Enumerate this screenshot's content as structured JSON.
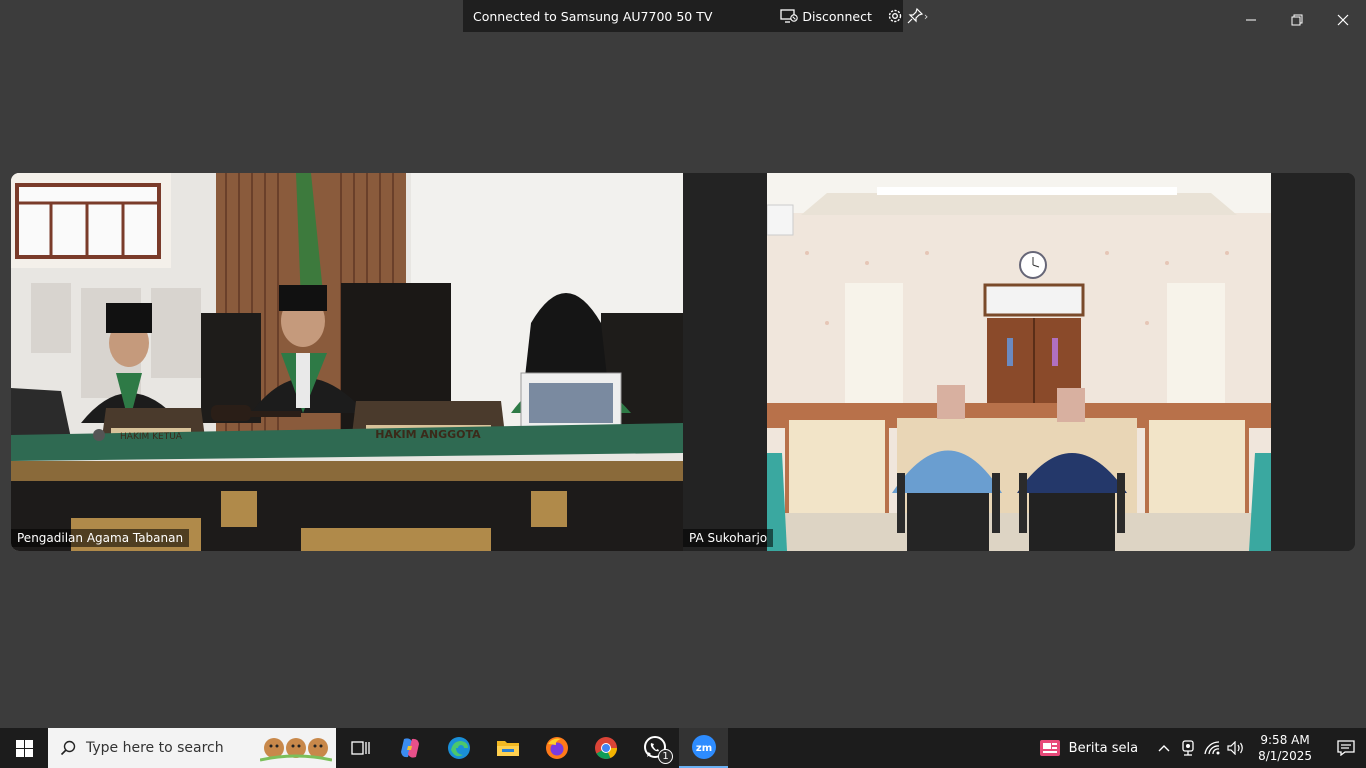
{
  "cast_bar": {
    "title": "Connected to Samsung AU7700 50 TV",
    "disconnect_label": "Disconnect"
  },
  "video": {
    "left_participant": "Pengadilan Agama Tabanan",
    "right_participant": "PA Sukoharjo",
    "bench_plate_left": "HAKIM KETUA",
    "bench_plate_right": "HAKIM ANGGOTA"
  },
  "taskbar": {
    "search_placeholder": "Type here to search",
    "whatsapp_badge": "1",
    "news_label": "Berita sela",
    "time": "9:58 AM",
    "date": "8/1/2025"
  },
  "colors": {
    "background": "#3c3c3c",
    "taskbar": "#1c1c1c",
    "accent": "#6ab0f3"
  }
}
